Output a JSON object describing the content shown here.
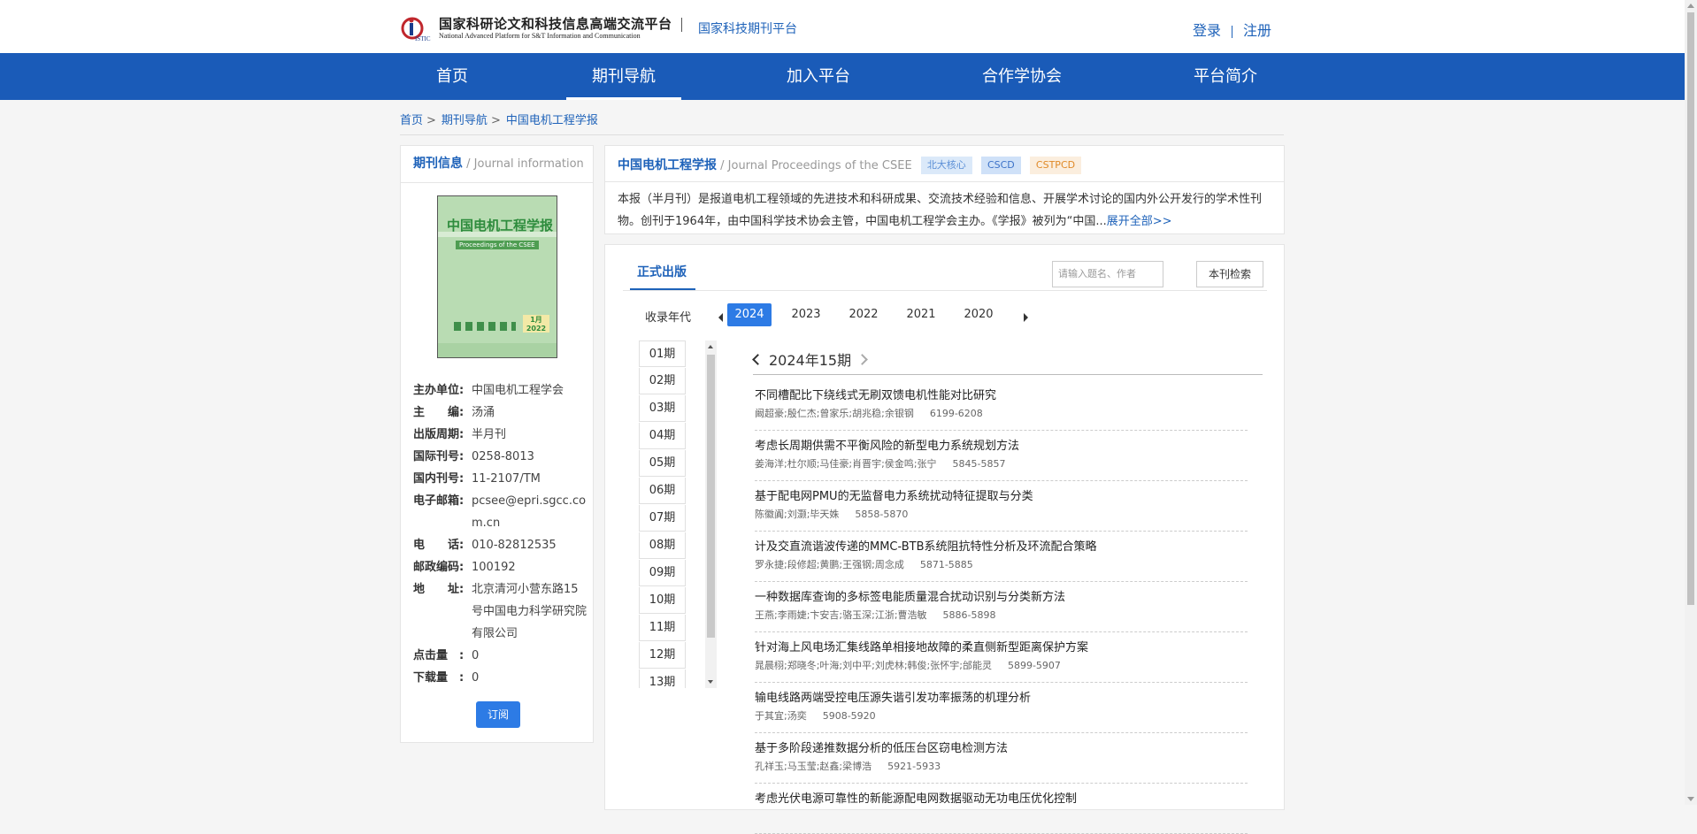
{
  "header": {
    "logo_cn": "国家科研论文和科技信息高端交流平台",
    "logo_en": "National Advanced Platform for S&T Information and Communication",
    "logo_mark": "ISTIC",
    "sub_platform": "国家科技期刊平台",
    "login": "登录",
    "register": "注册"
  },
  "nav": [
    "首页",
    "期刊导航",
    "加入平台",
    "合作学协会",
    "平台简介"
  ],
  "nav_active": "期刊导航",
  "breadcrumb": [
    "首页",
    "期刊导航",
    "中国电机工程学报"
  ],
  "left_panel": {
    "title": "期刊信息",
    "title_en": "/ Journal information",
    "cover": {
      "title": "中国电机工程学报",
      "subtitle": "Proceedings of the CSEE",
      "issue": "1月 2022"
    },
    "info": [
      {
        "k": "主办单位:",
        "v": "中国电机工程学会"
      },
      {
        "k": "主　　编:",
        "v": "汤涌"
      },
      {
        "k": "出版周期:",
        "v": "半月刊"
      },
      {
        "k": "国际刊号:",
        "v": "0258-8013"
      },
      {
        "k": "国内刊号:",
        "v": "11-2107/TM"
      },
      {
        "k": "电子邮箱:",
        "v": "pcsee@epri.sgcc.com.cn"
      },
      {
        "k": "电　　话:",
        "v": "010-82812535"
      },
      {
        "k": "邮政编码:",
        "v": "100192"
      },
      {
        "k": "地　　址:",
        "v": "北京清河小营东路15号中国电力科学研究院有限公司"
      },
      {
        "k": "点击量　:",
        "v": "0"
      },
      {
        "k": "下载量　:",
        "v": "0"
      }
    ],
    "subscribe": "订阅"
  },
  "journal": {
    "title": "中国电机工程学报",
    "title_en": "/ Journal Proceedings of the CSEE",
    "badges": [
      "北大核心",
      "CSCD",
      "CSTPCD"
    ],
    "description": "本报（半月刊）是报道电机工程领域的先进技术和科研成果、交流技术经验和信息、开展学术讨论的国内外公开发行的学术性刊物。创刊于1964年，由中国科学技术协会主管，中国电机工程学会主办。《学报》被列为“中国...",
    "more": "展开全部>>"
  },
  "issues": {
    "tab": "正式出版",
    "search_placeholder": "请输入题名、作者",
    "search_button": "本刊检索",
    "year_label": "收录年代",
    "years": [
      "2024",
      "2023",
      "2022",
      "2021",
      "2020"
    ],
    "selected_year": "2024",
    "issue_list": [
      "01期",
      "02期",
      "03期",
      "04期",
      "05期",
      "06期",
      "07期",
      "08期",
      "09期",
      "10期",
      "11期",
      "12期",
      "13期"
    ],
    "current_issue": "2024年15期",
    "articles": [
      {
        "title": "不同槽配比下绕线式无刷双馈电机性能对比研究",
        "authors": "阚超豪;殷仁杰;曾家乐;胡兆稳;余银钢",
        "pages": "6199-6208"
      },
      {
        "title": "考虑长周期供需不平衡风险的新型电力系统规划方法",
        "authors": "姜海洋;杜尔顺;马佳豪;肖晋宇;侯金鸣;张宁",
        "pages": "5845-5857"
      },
      {
        "title": "基于配电网PMU的无监督电力系统扰动特征提取与分类",
        "authors": "陈徽阗;刘灏;毕天姝",
        "pages": "5858-5870"
      },
      {
        "title": "计及交直流谐波传递的MMC-BTB系统阻抗特性分析及环流配合策略",
        "authors": "罗永捷;段修超;黄鹏;王强钢;周念成",
        "pages": "5871-5885"
      },
      {
        "title": "一种数据库查询的多标签电能质量混合扰动识别与分类新方法",
        "authors": "王燕;李雨婕;卞安吉;骆玉深;江浙;曹浩敏",
        "pages": "5886-5898"
      },
      {
        "title": "针对海上风电场汇集线路单相接地故障的柔直侧新型距离保护方案",
        "authors": "晁晨栩;郑晓冬;叶海;刘中平;刘虎林;韩俊;张怀宇;邰能灵",
        "pages": "5899-5907"
      },
      {
        "title": "输电线路两端受控电压源失谐引发功率振荡的机理分析",
        "authors": "于其宜;汤奕",
        "pages": "5908-5920"
      },
      {
        "title": "基于多阶段递推数据分析的低压台区窃电检测方法",
        "authors": "孔祥玉;马玉莹;赵鑫;梁博浩",
        "pages": "5921-5933"
      },
      {
        "title": "考虑光伏电源可靠性的新能源配电网数据驱动无功电压优化控制",
        "authors": "",
        "pages": ""
      }
    ]
  },
  "colors": {
    "brand": "#1a5bb8",
    "link": "#1e62b9",
    "active_year": "#2d7be5"
  }
}
